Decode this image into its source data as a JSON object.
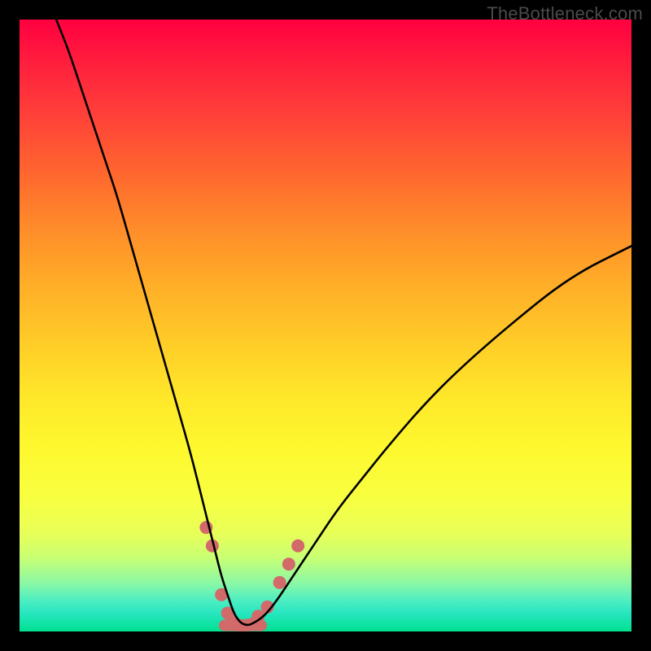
{
  "watermark": "TheBottleneck.com",
  "chart_data": {
    "type": "line",
    "title": "",
    "xlabel": "",
    "ylabel": "",
    "xlim": [
      0,
      100
    ],
    "ylim": [
      0,
      100
    ],
    "grid": false,
    "series": [
      {
        "name": "bottleneck-curve",
        "x": [
          6,
          8,
          10,
          12,
          14,
          16,
          18,
          20,
          22,
          24,
          26,
          28,
          30,
          31,
          32,
          33,
          34,
          35,
          36,
          37,
          38,
          40,
          42,
          44,
          46,
          48,
          52,
          56,
          60,
          66,
          72,
          80,
          90,
          100
        ],
        "y": [
          100,
          95,
          89,
          83,
          77,
          71,
          64,
          57,
          50,
          43,
          36,
          29,
          21,
          17,
          13,
          9,
          6,
          3,
          1.5,
          1,
          1.2,
          2.5,
          5,
          8,
          11,
          14,
          20,
          25,
          30,
          37,
          43,
          50,
          58,
          63
        ],
        "color": "#000000",
        "linewidth": 2.6
      }
    ],
    "markers": {
      "name": "highlight-dots",
      "points": [
        {
          "x": 30.5,
          "y": 17
        },
        {
          "x": 31.5,
          "y": 14
        },
        {
          "x": 33.0,
          "y": 6
        },
        {
          "x": 34.0,
          "y": 3
        },
        {
          "x": 35.0,
          "y": 1.5
        },
        {
          "x": 36.0,
          "y": 1
        },
        {
          "x": 37.0,
          "y": 1
        },
        {
          "x": 38.0,
          "y": 1.2
        },
        {
          "x": 39.0,
          "y": 2.5
        },
        {
          "x": 40.5,
          "y": 4
        },
        {
          "x": 42.5,
          "y": 8
        },
        {
          "x": 44.0,
          "y": 11
        },
        {
          "x": 45.5,
          "y": 14
        }
      ],
      "color": "#d36a6a",
      "radius_px": 8
    },
    "trough_band": {
      "x_start": 33.5,
      "x_end": 39.5,
      "y": 1.0,
      "color": "#d36a6a",
      "thickness_px": 14
    }
  }
}
